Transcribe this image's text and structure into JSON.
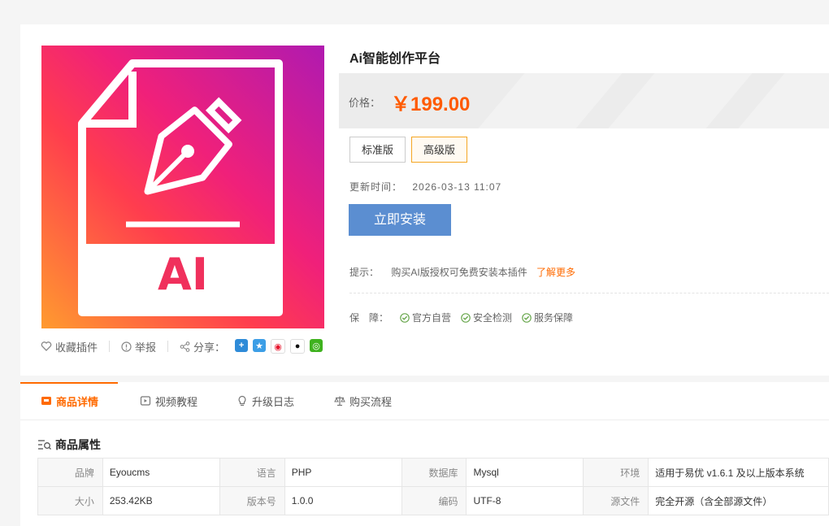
{
  "product": {
    "title": "Ai智能创作平台",
    "image_text": "AI",
    "price_label": "价格：",
    "price_value": "￥199.00",
    "versions": [
      "标准版",
      "高级版"
    ],
    "update_label": "更新时间：",
    "update_time": "2026-03-13 11:07",
    "install_label": "立即安装",
    "tip_label": "提示：",
    "tip_text": "购买AI版授权可免费安装本插件",
    "tip_more": "了解更多",
    "guarantee_label": "保　障：",
    "guarantees": [
      "官方自营",
      "安全检测",
      "服务保障"
    ]
  },
  "actions": {
    "favorite": "收藏插件",
    "report": "举报",
    "share": "分享："
  },
  "tabs": [
    {
      "label": "商品详情",
      "icon": "store-icon"
    },
    {
      "label": "视频教程",
      "icon": "video-icon"
    },
    {
      "label": "升级日志",
      "icon": "bulb-icon"
    },
    {
      "label": "购买流程",
      "icon": "scale-icon"
    }
  ],
  "attributes_title": "商品属性",
  "attributes": [
    [
      {
        "k": "品牌",
        "v": "Eyoucms"
      },
      {
        "k": "语言",
        "v": "PHP"
      },
      {
        "k": "数据库",
        "v": "Mysql"
      },
      {
        "k": "环境",
        "v": "适用于易优 v1.6.1 及以上版本系统"
      }
    ],
    [
      {
        "k": "大小",
        "v": "253.42KB"
      },
      {
        "k": "版本号",
        "v": "1.0.0"
      },
      {
        "k": "编码",
        "v": "UTF-8"
      },
      {
        "k": "源文件",
        "v": "完全开源（含全部源文件）"
      }
    ]
  ],
  "colors": {
    "accent": "#ff6a00",
    "install_button": "#5b8ed1",
    "price": "#ff5a00"
  }
}
